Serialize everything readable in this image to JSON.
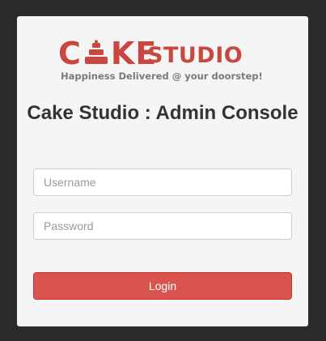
{
  "brand": {
    "logo_cake_text": "C KE",
    "logo_studio_text": "STUDIO",
    "tagline": "Happiness Delivered @ your doorstep!",
    "color": "#c9473f"
  },
  "login": {
    "title": "Cake Studio : Admin Console",
    "username_placeholder": "Username",
    "password_placeholder": "Password",
    "button_label": "Login",
    "button_color": "#d9534f"
  }
}
